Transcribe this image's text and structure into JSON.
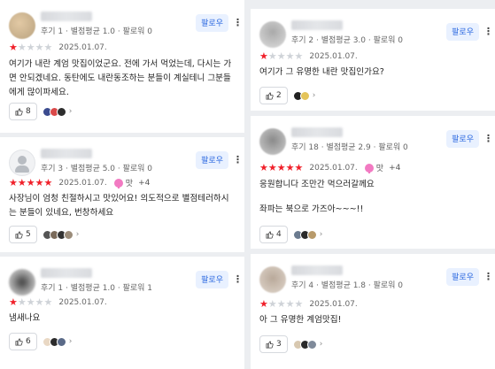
{
  "colors": {
    "accent": "#2f6be0",
    "star_on": "#f0202a",
    "star_off": "#cfd3d8",
    "taste_pink": "#f27ac2"
  },
  "icons": {
    "more": "more-vertical-icon",
    "like": "thumb-up-icon",
    "chevron": "chevron-right-icon",
    "taste": "taste-badge-icon"
  },
  "reviews": [
    {
      "meta": "후기 1 · 별점평균 1.0 · 팔로워 0",
      "follow": "팔로우",
      "rating": 1,
      "date": "2025.01.07.",
      "lines": [
        "여기가 내란 계엄 맛집이었군요.  전에 가서 먹었는데, 다시는 가면 안되겠네요.  동탄에도 내란동조하는 분들이 계실테니 그분들에게 많이파세요."
      ],
      "likes": "8"
    },
    {
      "meta": "후기 3 · 별점평균 5.0 · 팔로워 0",
      "follow": "팔로우",
      "rating": 5,
      "date": "2025.01.07.",
      "taste": "맛",
      "taste_more": "+4",
      "lines": [
        "사장님이 엄청 친절하시고 맛있어요! 의도적으로 별점테러하시는 분들이 있네요, 번창하세요"
      ],
      "likes": "5"
    },
    {
      "meta": "후기 1 · 별점평균 1.0 · 팔로워 1",
      "follow": "팔로우",
      "rating": 1,
      "date": "2025.01.07.",
      "lines": [
        "냄새나요"
      ],
      "likes": "6"
    },
    {
      "meta": "후기 2 · 별점평균 3.0 · 팔로워 0",
      "follow": "팔로우",
      "rating": 1,
      "date": "2025.01.07.",
      "lines": [
        "여기가 그 유명한 내란 맛집인가요?"
      ],
      "likes": "2"
    },
    {
      "meta": "후기 18 · 별점평균 2.9 · 팔로워 0",
      "follow": "팔로우",
      "rating": 5,
      "date": "2025.01.07.",
      "taste": "맛",
      "taste_more": "+4",
      "lines": [
        "응원합니다 조만간 먹으러갈께요",
        "좌파는 북으로 가즈아~~~!!"
      ],
      "likes": "4"
    },
    {
      "meta": "후기 4 · 별점평균 1.8 · 팔로워 0",
      "follow": "팔로우",
      "rating": 1,
      "date": "2025.01.07.",
      "lines": [
        "아 그 유명한 계엄맛집!"
      ],
      "likes": "3"
    }
  ]
}
